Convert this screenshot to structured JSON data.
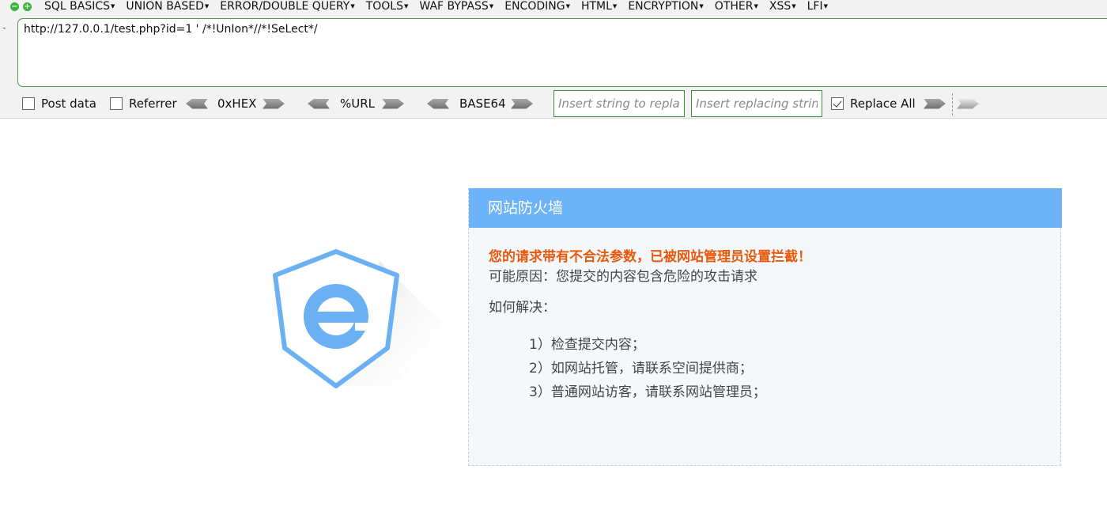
{
  "menubar": {
    "items": [
      "SQL BASICS",
      "UNION BASED",
      "ERROR/DOUBLE QUERY",
      "TOOLS",
      "WAF BYPASS",
      "ENCODING",
      "HTML",
      "ENCRYPTION",
      "OTHER",
      "XSS",
      "LFI"
    ]
  },
  "url_box": {
    "value": "http://127.0.0.1/test.php?id=1 ' /*!UnIon*//*!SeLect*/"
  },
  "toolbar": {
    "post_data_label": "Post data",
    "referrer_label": "Referrer",
    "hex_label": "0xHEX",
    "url_label": "%URL",
    "base64_label": "BASE64",
    "replace_placeholder": "Insert string to replace",
    "replacing_placeholder": "Insert replacing string",
    "replace_all_label": "Replace All",
    "post_data_checked": false,
    "referrer_checked": false,
    "replace_all_checked": true
  },
  "firewall": {
    "title": "网站防火墙",
    "warning": "您的请求带有不合法参数，已被网站管理员设置拦截！",
    "reason": "可能原因：您提交的内容包含危险的攻击请求",
    "how_label": "如何解决：",
    "steps": [
      "1）检查提交内容；",
      "2）如网站托管，请联系空间提供商；",
      "3）普通网站访客，请联系网站管理员；"
    ]
  },
  "colors": {
    "header_blue": "#6db3f7",
    "warning_orange": "#e8590c",
    "input_border_green": "#3d8f3d",
    "icon_green": "#3bb33b"
  }
}
